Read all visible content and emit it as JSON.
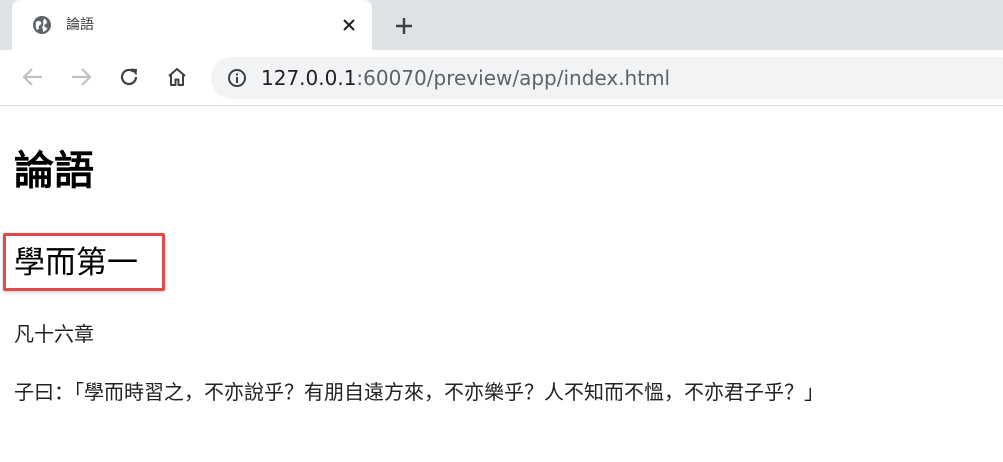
{
  "browser": {
    "tab": {
      "title": "論語",
      "favicon": "globe-icon",
      "close_icon": "close-icon"
    },
    "new_tab_icon": "plus-icon",
    "nav": {
      "back_icon": "back-arrow-icon",
      "forward_icon": "forward-arrow-icon",
      "reload_icon": "reload-icon",
      "home_icon": "home-icon"
    },
    "address": {
      "security_icon": "info-icon",
      "host": "127.0.0.1",
      "rest": ":60070/preview/app/index.html"
    },
    "colors": {
      "tabstrip": "#dee1e6",
      "omnibox": "#f1f3f4",
      "highlight": "#e04a4a"
    }
  },
  "page": {
    "title": "論語",
    "chapter": "學而第一",
    "subtitle": "凡十六章",
    "passage": "子曰：「學而時習之，不亦說乎？有朋自遠方來，不亦樂乎？人不知而不慍，不亦君子乎？」"
  }
}
